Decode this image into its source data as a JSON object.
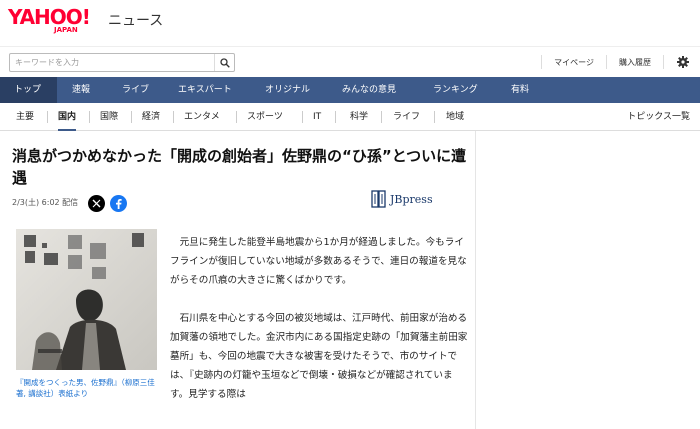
{
  "header": {
    "logo_yahoo": "YAHOO!",
    "logo_japan": "JAPAN",
    "service_name": "ニュース"
  },
  "search": {
    "placeholder": "キーワードを入力",
    "value": ""
  },
  "top_links": {
    "mypage": "マイページ",
    "history": "購入履歴"
  },
  "main_nav": [
    {
      "label": "トップ",
      "active": true
    },
    {
      "label": "速報",
      "active": false
    },
    {
      "label": "ライブ",
      "active": false
    },
    {
      "label": "エキスパート",
      "active": false
    },
    {
      "label": "オリジナル",
      "active": false
    },
    {
      "label": "みんなの意見",
      "active": false
    },
    {
      "label": "ランキング",
      "active": false
    },
    {
      "label": "有料",
      "active": false
    }
  ],
  "sub_nav": [
    {
      "label": "主要",
      "active": false
    },
    {
      "label": "国内",
      "active": true
    },
    {
      "label": "国際",
      "active": false
    },
    {
      "label": "経済",
      "active": false
    },
    {
      "label": "エンタメ",
      "active": false
    },
    {
      "label": "スポーツ",
      "active": false
    },
    {
      "label": "IT",
      "active": false
    },
    {
      "label": "科学",
      "active": false
    },
    {
      "label": "ライフ",
      "active": false
    },
    {
      "label": "地域",
      "active": false
    }
  ],
  "topics_link": "トピックス一覧",
  "article": {
    "title": "消息がつかめなかった「開成の創始者」佐野鼎の“ひ孫”とついに遭遇",
    "date": "2/3(土) 6:02 配信",
    "publisher": "JBpress",
    "photo_caption": "『開成をつくった男、佐野鼎』（柳原三佳著, 講談社）表紙より",
    "paragraphs": [
      "元旦に発生した能登半島地震から1か月が経過しました。今もライフラインが復旧していない地域が多数あるそうで、連日の報道を見ながらその爪痕の大きさに驚くばかりです。",
      "石川県を中心とする今回の被災地域は、江戸時代、前田家が治める加賀藩の領地でした。金沢市内にある国指定史跡の「加賀藩主前田家墓所」も、今回の地震で大きな被害を受けたそうで、市のサイトでは、『史跡内の灯籠や玉垣などで倒壊・破損などが確認されています。見学する際は"
    ]
  },
  "icons": {
    "search": "search-icon",
    "settings": "gear-icon",
    "x": "x-share-icon",
    "facebook": "facebook-share-icon"
  },
  "colors": {
    "brand_red": "#ff0033",
    "nav_blue": "#3d5a8a",
    "nav_active": "#2a3f63",
    "caption_link": "#1a6fcf",
    "jbpress_navy": "#1b3a6b"
  }
}
